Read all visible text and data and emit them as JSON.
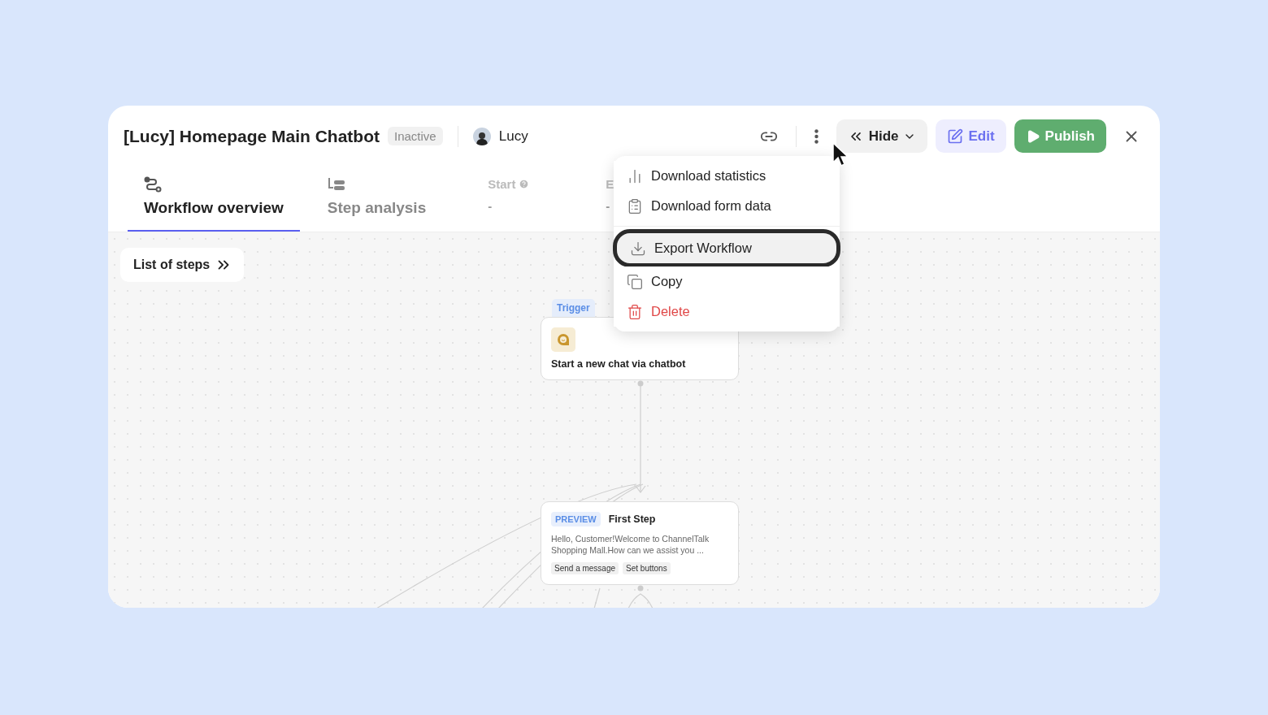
{
  "header": {
    "title": "[Lucy] Homepage Main Chatbot",
    "status": "Inactive",
    "owner": "Lucy",
    "actions": [
      {
        "kind": "hide",
        "label": "Hide"
      },
      {
        "kind": "edit",
        "label": "Edit"
      },
      {
        "kind": "publish",
        "label": "Publish"
      }
    ]
  },
  "tabs": [
    {
      "kind": "workflow",
      "label": "Workflow overview",
      "selected": true
    },
    {
      "kind": "steps",
      "label": "Step analysis",
      "selected": false
    }
  ],
  "stats": [
    {
      "label": "Start",
      "value": "-",
      "help": true
    },
    {
      "label": "E",
      "value": "-"
    }
  ],
  "canvas": {
    "list_button": "List of steps",
    "trigger": {
      "tag": "Trigger",
      "title": "Start a new chat via chatbot"
    },
    "step": {
      "badge": "PREVIEW",
      "title": "First Step",
      "text": "Hello, Customer!Welcome to ChannelTalk Shopping Mall.How can we assist you ...",
      "chips": [
        "Send a message",
        "Set buttons"
      ]
    }
  },
  "menu": {
    "items": [
      {
        "kind": "stats",
        "label": "Download statistics",
        "danger": false,
        "highlighted": false
      },
      {
        "kind": "form",
        "label": "Download form data",
        "danger": false,
        "highlighted": false
      },
      {
        "kind": "export",
        "label": "Export Workflow",
        "danger": false,
        "highlighted": true
      },
      {
        "kind": "copy",
        "label": "Copy",
        "danger": false,
        "highlighted": false
      },
      {
        "kind": "delete",
        "label": "Delete",
        "danger": true,
        "highlighted": false
      }
    ]
  }
}
